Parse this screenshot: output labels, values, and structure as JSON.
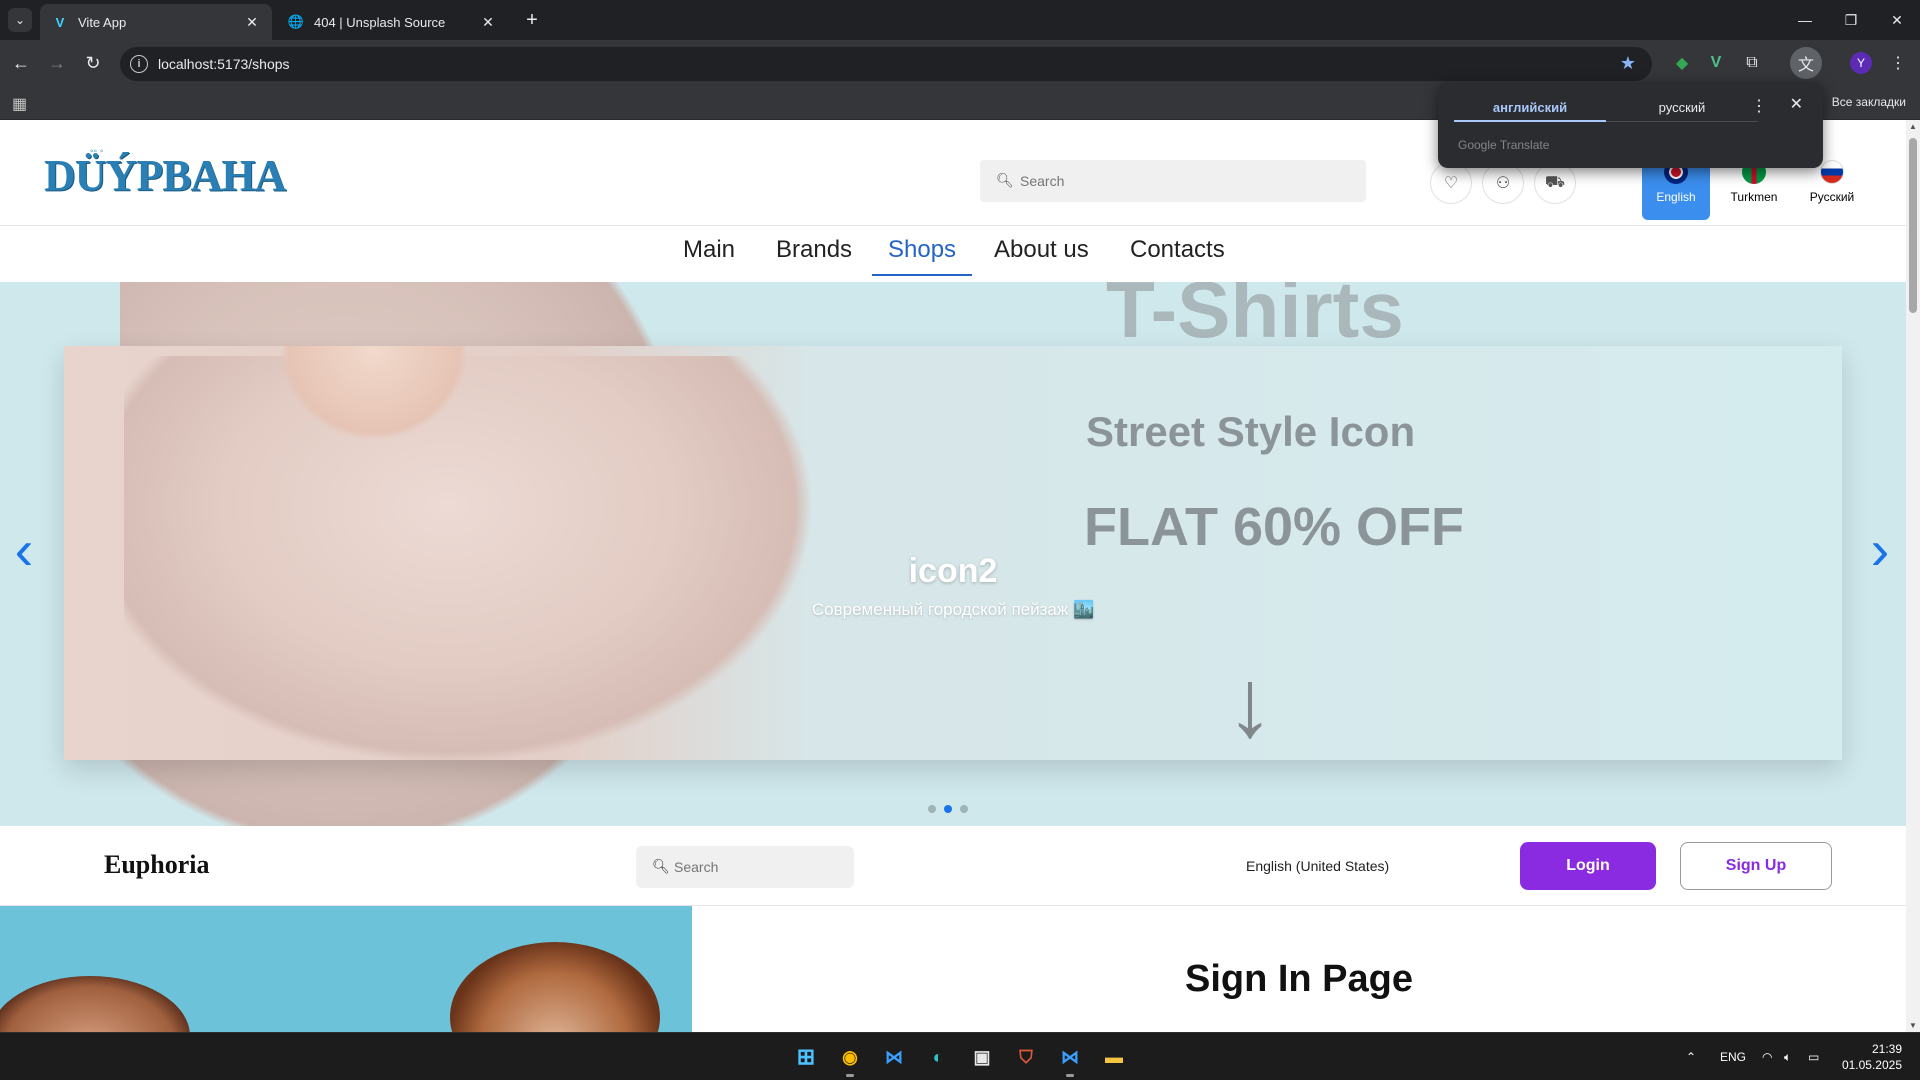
{
  "browser": {
    "tabs": [
      {
        "title": "Vite App",
        "active": true,
        "icon": "vite-logo-icon"
      },
      {
        "title": "404 | Unsplash Source",
        "active": false,
        "icon": "globe-icon"
      }
    ],
    "url": "localhost:5173/shops",
    "all_bookmarks": "Все закладки",
    "profile_initial": "Y"
  },
  "translate_popup": {
    "source_lang": "английский",
    "target_lang": "русский",
    "brand": "Google Translate"
  },
  "site": {
    "logo": "DÜÝPBAHA",
    "search_placeholder": "Search",
    "languages": [
      {
        "label": "English",
        "active": true
      },
      {
        "label": "Turkmen",
        "active": false
      },
      {
        "label": "Русский",
        "active": false
      }
    ],
    "nav": [
      {
        "label": "Main",
        "active": false
      },
      {
        "label": "Brands",
        "active": false
      },
      {
        "label": "Shops",
        "active": true
      },
      {
        "label": "About us",
        "active": false
      },
      {
        "label": "Contacts",
        "active": false
      }
    ]
  },
  "hero": {
    "bg_text": "T-Shirts",
    "ad_line1": "Street Style Icon",
    "ad_line2": "FLAT 60% OFF",
    "slide_title": "icon2",
    "slide_subtitle": "Современный городской пейзаж 🏙️",
    "dots": {
      "count": 3,
      "active_index": 1
    }
  },
  "euphoria": {
    "logo": "Euphoria",
    "search_placeholder": "Search",
    "language": "English (United States)",
    "login_label": "Login",
    "signup_label": "Sign Up",
    "signin_title": "Sign In Page",
    "accent_color": "#8a2be2"
  },
  "taskbar": {
    "lang": "ENG",
    "time": "21:39",
    "date": "01.05.2025"
  }
}
